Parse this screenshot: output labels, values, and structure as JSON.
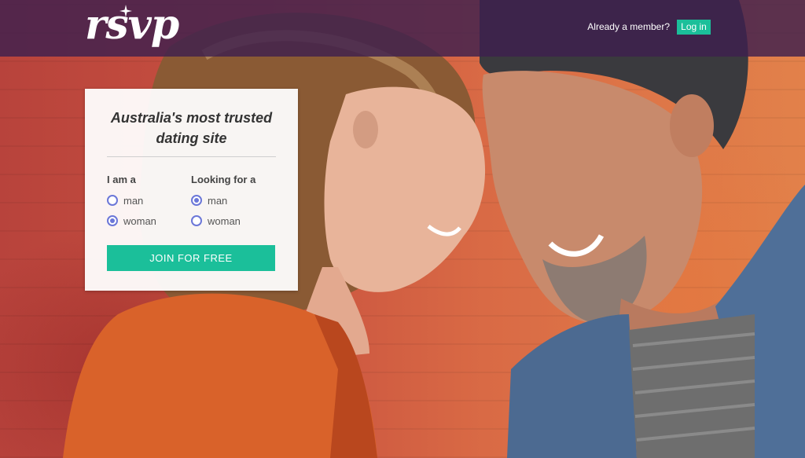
{
  "header": {
    "logo_text": "rsvp",
    "already_member": "Already a member?",
    "login_label": "Log in"
  },
  "signup": {
    "tagline": "Australia's most trusted dating site",
    "i_am_label": "I am a",
    "looking_for_label": "Looking for a",
    "i_am_options": [
      {
        "label": "man",
        "selected": false
      },
      {
        "label": "woman",
        "selected": true
      }
    ],
    "looking_for_options": [
      {
        "label": "man",
        "selected": true
      },
      {
        "label": "woman",
        "selected": false
      }
    ],
    "join_label": "JOIN FOR FREE"
  },
  "colors": {
    "accent": "#1bbf9a",
    "radio": "#6b77d8",
    "topbar": "#3e204e"
  }
}
